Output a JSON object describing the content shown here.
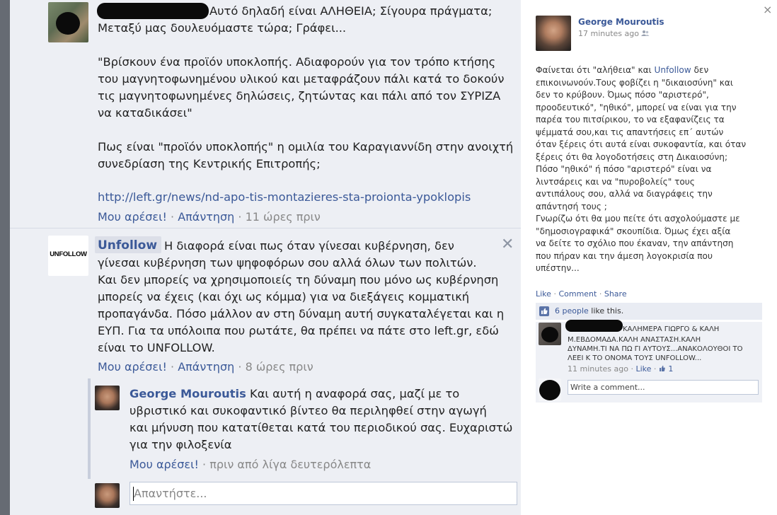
{
  "thread": {
    "first_comment": {
      "line1": "Αυτό δηλαδή είναι ΑΛΗΘΕΙΑ; Σίγουρα πράγματα;",
      "line2": "Μεταξύ μας δουλευόμαστε τώρα; Γράφει...",
      "para2": [
        "\"Βρίσκουν ένα προϊόν υποκλοπής. Αδιαφορούν για τον τρόπο κτήσης",
        "του μαγνητοφωνημένου υλικού και μεταφράζουν πάλι κατά το δοκούν",
        "τις μαγνητοφωνημένες δηλώσεις, ζητώντας και πάλι από τον ΣΥΡΙΖΑ",
        "να καταδικάσει\""
      ],
      "para3": [
        "Πως είναι \"προϊόν υποκλοπής\" η ομιλία του Καραγιαννίδη στην ανοιχτή",
        "συνεδρίαση της Κεντρικής Επιτροπής;"
      ],
      "link": "http://left.gr/news/nd-apo-tis-montazieres-sta-proionta-ypoklopis",
      "like": "Μου αρέσει!",
      "reply": "Απάντηση",
      "time": "11 ώρες πριν",
      "sep": "·"
    },
    "second_comment": {
      "author": "Unfollow",
      "avatar_text": "UNFOLLOW",
      "lines": [
        "Η διαφορά είναι πως όταν γίνεσαι κυβέρνηση, δεν",
        "γίνεσαι κυβέρνηση των ψηφοφόρων σου αλλά όλων των πολιτών.",
        "Και δεν μπορείς να χρησιμοποιείς τη δύναμη που μόνο ως κυβέρνηση",
        "μπορείς να έχεις (και όχι ως κόμμα) για να διεξάγεις κομματική",
        "προπαγάνδα. Πόσο μάλλον αν στη δύναμη αυτή συγκαταλέγεται και η",
        "ΕΥΠ. Για τα υπόλοιπα που ρωτάτε, θα πρέπει να πάτε στο left.gr, εδώ",
        "είναι το UNFOLLOW."
      ],
      "like": "Μου αρέσει!",
      "reply": "Απάντηση",
      "time": "8 ώρες πριν",
      "sep": "·",
      "close": "✕"
    },
    "reply": {
      "author": "George Mouroutis",
      "lines": [
        "Και αυτή η αναφορά σας, μαζί με το",
        "υβριστικό και συκοφαντικό βίντεο θα περιληφθεί στην αγωγή",
        "και μήνυση που κατατίθεται κατά του περιοδικού σας. Ευχαριστώ",
        "για την φιλοξενία"
      ],
      "like": "Μου αρέσει!",
      "time": "πριν από λίγα δευτερόλεπτα",
      "sep": "·"
    },
    "reply_input": {
      "placeholder": "Απαντήστε..."
    }
  },
  "right_panel": {
    "close": "×",
    "author": "George Mouroutis",
    "time": "17 minutes ago",
    "post_line1_a": "Φαίνεται ότι \"αλήθεια\" και ",
    "post_line1_link": "Unfollow",
    "post_line1_b": " δεν",
    "post_lines": [
      "επικοινωνούν.Τους φοβίζει η \"δικαιοσύνη\" και",
      "δεν το κρύβουν. Όμως πόσο \"αριστερό\",",
      "προοδευτικό\", \"ηθικό\", μπορεί να είναι για την",
      "παρέα του πιτσίρικου, το να εξαφανίζεις τα",
      "ψέμματά σου,και τις απαντήσεις επ΄ αυτών",
      "όταν ξέρεις ότι αυτά είναι συκοφαντία, και όταν",
      "ξέρεις ότι θα λογοδοτήσεις στη Δικαιοσύνη;",
      "Πόσο \"ηθικό\" ή πόσο \"αριστερό\" είναι να",
      "λιντσάρεις και να \"πυροβολείς\" τους",
      "αντιπάλους σου, αλλά να διαγράφεις την",
      "απάντησή τους ;",
      "Γνωρίζω ότι θα μου πείτε ότι ασχολούμαστε με",
      "\"δημοσιογραφικά\" σκουπίδια. Όμως έχει αξία",
      "να δείτε το σχόλιο που έκαναν, την απάντηση",
      "που πήραν και την άμεση λογοκρισία που",
      "υπέστην..."
    ],
    "actions": {
      "like": "Like",
      "comment": "Comment",
      "share": "Share",
      "sep": "·"
    },
    "likes": {
      "count": "6 people",
      "suffix": "like this."
    },
    "comment": {
      "lines": [
        "ΚΑΛΗΜΕΡΑ ΓΙΩΡΓΟ & ΚΑΛΗ",
        "Μ.ΕΒΔΟΜΑΔΑ.ΚΑΛΗ ΑΝΑΣΤΑΣΗ.ΚΑΛΗ",
        "ΔΥΝΑΜΗ.ΤΙ ΝΑ ΠΩ ΓΙ ΑΥΤΟΥΣ...ΑΝΑΚΟΛΟΥΘΟΙ ΤΟ",
        "ΛΕΕΙ Κ ΤΟ ΟΝΟΜΑ ΤΟΥΣ UNFOLLOW..."
      ],
      "time": "11 minutes ago",
      "like": "Like",
      "likes_count": "1",
      "sep": "·"
    },
    "write_comment": {
      "placeholder": "Write a comment..."
    }
  },
  "colors": {
    "link": "#3b5998",
    "left_bg": "#edeff4",
    "meta": "#888888"
  }
}
